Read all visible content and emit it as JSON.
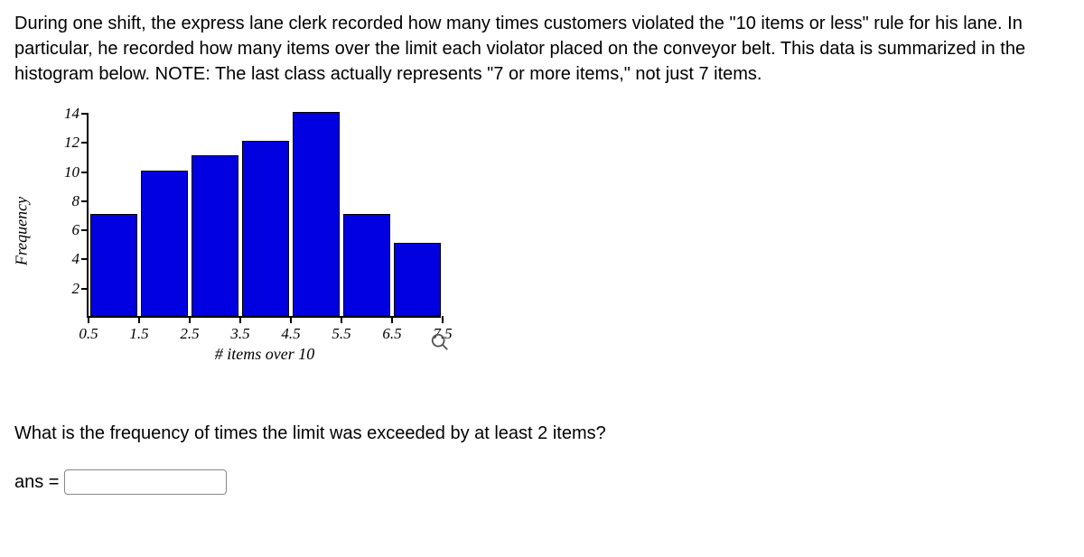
{
  "problem_text": "During one shift, the express lane clerk recorded how many times customers violated the \"10 items or less\" rule for his lane. In particular, he recorded how many items over the limit each violator placed on the conveyor belt. This data is summarized in the histogram below. NOTE: The last class actually represents \"7 or more items,\" not just 7 items.",
  "question_text": "What is the frequency of times the limit was exceeded by at least 2 items?",
  "answer_label": "ans =",
  "answer_value": "",
  "chart_data": {
    "type": "bar",
    "title": "",
    "xlabel": "# items over 10",
    "ylabel": "Frequency",
    "ylim": [
      0,
      14
    ],
    "yticks": [
      2,
      4,
      6,
      8,
      10,
      12,
      14
    ],
    "xticks": [
      0.5,
      1.5,
      2.5,
      3.5,
      4.5,
      5.5,
      6.5,
      7.5
    ],
    "categories": [
      "1",
      "2",
      "3",
      "4",
      "5",
      "6",
      "7"
    ],
    "values": [
      7,
      10,
      11,
      12,
      14,
      7,
      5
    ]
  }
}
